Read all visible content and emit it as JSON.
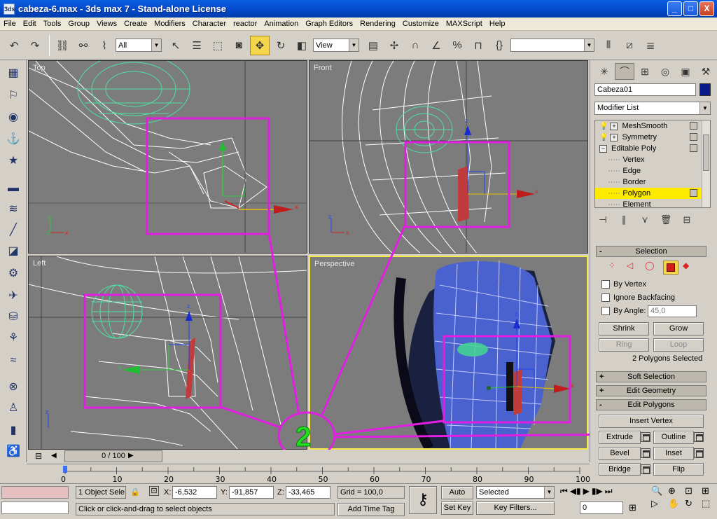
{
  "window": {
    "title": "cabeza-6.max   - 3ds max 7   - Stand-alone License",
    "app_icon_text": "3ds",
    "buttons": {
      "minimize": "_",
      "maximize": "□",
      "close": "X"
    }
  },
  "menu": [
    "File",
    "Edit",
    "Tools",
    "Group",
    "Views",
    "Create",
    "Modifiers",
    "Character",
    "reactor",
    "Animation",
    "Graph Editors",
    "Rendering",
    "Customize",
    "MAXScript",
    "Help"
  ],
  "toolbar": {
    "selection_filter": "All",
    "ref_coord": "View",
    "selection_set": ""
  },
  "viewports": {
    "top": {
      "label": "Top"
    },
    "front": {
      "label": "Front"
    },
    "left": {
      "label": "Left"
    },
    "perspective": {
      "label": "Perspective"
    },
    "annotation_number": "2",
    "axis_labels": {
      "x": "x",
      "y": "y",
      "z": "z"
    }
  },
  "command_panel": {
    "object_name": "Cabeza01",
    "object_color": "#0b1a8a",
    "modifier_list": "Modifier List",
    "stack": [
      {
        "name": "MeshSmooth",
        "indent": 0,
        "expander": "+",
        "selected": false
      },
      {
        "name": "Symmetry",
        "indent": 0,
        "expander": "+",
        "selected": false
      },
      {
        "name": "Editable Poly",
        "indent": 0,
        "expander": "−",
        "selected": false
      },
      {
        "name": "Vertex",
        "indent": 1,
        "expander": "",
        "selected": false
      },
      {
        "name": "Edge",
        "indent": 1,
        "expander": "",
        "selected": false
      },
      {
        "name": "Border",
        "indent": 1,
        "expander": "",
        "selected": false
      },
      {
        "name": "Polygon",
        "indent": 1,
        "expander": "",
        "selected": true
      },
      {
        "name": "Element",
        "indent": 1,
        "expander": "",
        "selected": false
      }
    ],
    "selection": {
      "header": "Selection",
      "by_vertex": "By Vertex",
      "ignore_backfacing": "Ignore Backfacing",
      "by_angle": "By Angle:",
      "angle_value": "45,0",
      "shrink": "Shrink",
      "grow": "Grow",
      "ring": "Ring",
      "loop": "Loop",
      "status": "2 Polygons Selected"
    },
    "soft_selection": "Soft Selection",
    "edit_geometry": "Edit Geometry",
    "edit_polygons": "Edit Polygons",
    "buttons": {
      "insert_vertex": "Insert Vertex",
      "extrude": "Extrude",
      "outline": "Outline",
      "bevel": "Bevel",
      "inset": "Inset",
      "bridge": "Bridge",
      "flip": "Flip"
    }
  },
  "timeline": {
    "slider": "0 / 100",
    "ticks": [
      "0",
      "10",
      "20",
      "30",
      "40",
      "50",
      "60",
      "70",
      "80",
      "90",
      "100"
    ]
  },
  "status": {
    "selected": "1 Object Sele",
    "x_label": "X:",
    "x": "-6,532",
    "y_label": "Y:",
    "y": "-91,857",
    "z_label": "Z:",
    "z": "-33,465",
    "grid": "Grid = 100,0",
    "prompt": "Click or click-and-drag to select objects",
    "add_time_tag": "Add Time Tag",
    "auto_key": "Auto Key",
    "set_key": "Set Key",
    "key_mode": "Selected",
    "key_filters": "Key Filters...",
    "frame": "0"
  }
}
